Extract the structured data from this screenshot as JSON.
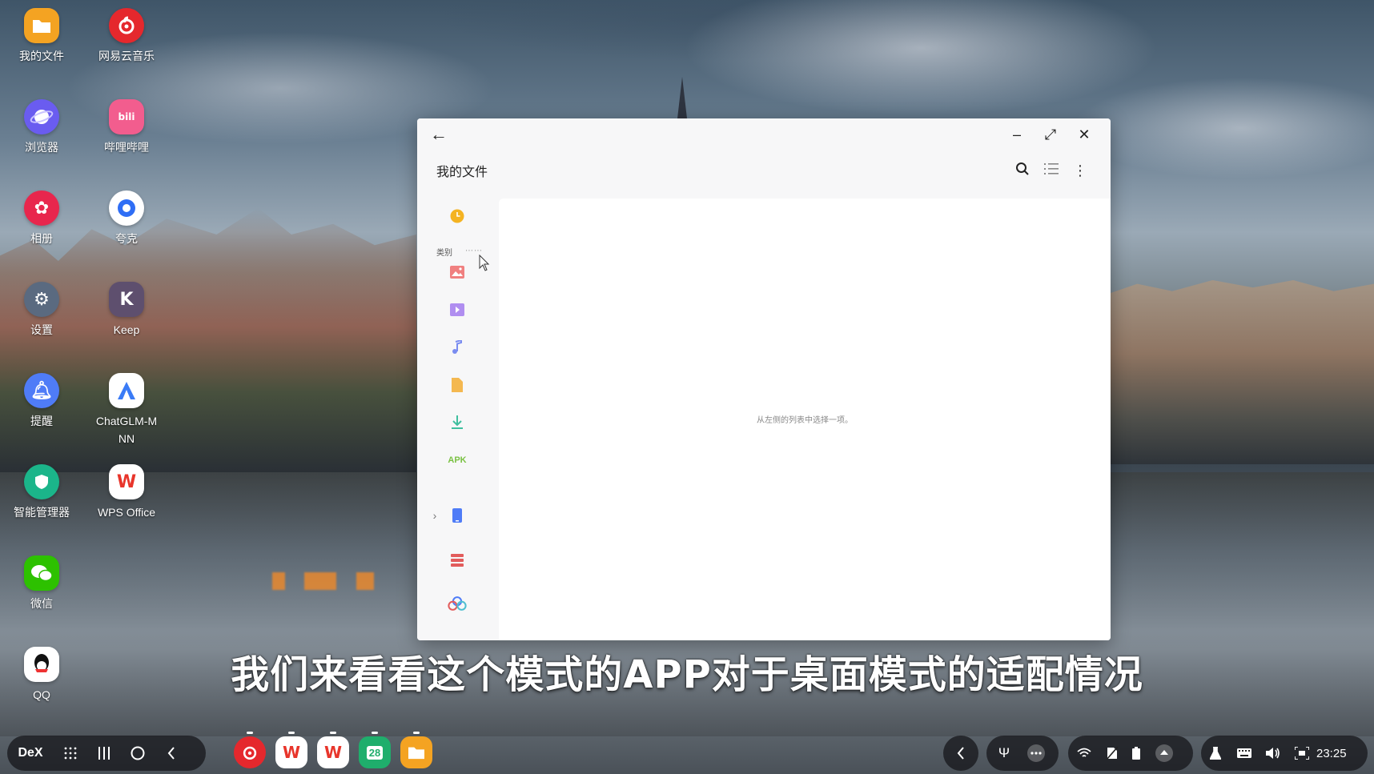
{
  "desktop": {
    "icons": [
      {
        "label": "我的文件",
        "icon": "folder-icon",
        "color": "#f4a322"
      },
      {
        "label": "网易云音乐",
        "icon": "netease-music-icon",
        "color": "#e5282d"
      },
      {
        "label": "浏览器",
        "icon": "browser-icon",
        "color": "#6a5cf0"
      },
      {
        "label": "哔哩哔哩",
        "icon": "bilibili-icon",
        "color": "#f25d8e"
      },
      {
        "label": "相册",
        "icon": "gallery-icon",
        "color": "#e8264d"
      },
      {
        "label": "夸克",
        "icon": "quark-icon",
        "color": "#ffffff"
      },
      {
        "label": "设置",
        "icon": "gear-icon",
        "color": "#5a6a80"
      },
      {
        "label": "Keep",
        "icon": "keep-icon",
        "color": "#5e4f6e"
      },
      {
        "label": "提醒",
        "icon": "bell-icon",
        "color": "#4f7cf7"
      },
      {
        "label": "ChatGLM-M NN",
        "icon": "chatglm-icon",
        "color": "#ffffff"
      },
      {
        "label": "智能管理器",
        "icon": "device-care-icon",
        "color": "#1bb58a"
      },
      {
        "label": "WPS Office",
        "icon": "wps-icon",
        "color": "#ffffff"
      },
      {
        "label": "微信",
        "icon": "wechat-icon",
        "color": "#2dc100"
      },
      {
        "label": "QQ",
        "icon": "qq-icon",
        "color": "#ffffff"
      }
    ]
  },
  "window": {
    "back_icon": "←",
    "minimize_icon": "–",
    "maximize_icon": "⤢",
    "close_icon": "✕",
    "title": "我的文件",
    "search_icon": "⌕",
    "list_icon": "☰",
    "more_icon": "⋮",
    "rail": {
      "category_label": "类别",
      "apk_label": "APK",
      "items": [
        "recent-icon",
        "images-icon",
        "videos-icon",
        "audio-icon",
        "documents-icon",
        "downloads-icon",
        "apk-icon",
        "internal-storage-icon",
        "storage-analysis-icon",
        "cloud-icon"
      ]
    },
    "empty_message": "从左侧的列表中选择一项。"
  },
  "subtitle": "我们来看看这个模式的APP对于桌面模式的适配情况",
  "taskbar": {
    "dex_label": "DeX",
    "calendar_day": "28",
    "time": "23:25"
  },
  "colors": {
    "accent_orange": "#f4a322",
    "rail_purple": "#9b7ff0",
    "rail_red": "#e25c5c",
    "rail_blue": "#4f7cf7",
    "apk_green": "#7ac143"
  }
}
